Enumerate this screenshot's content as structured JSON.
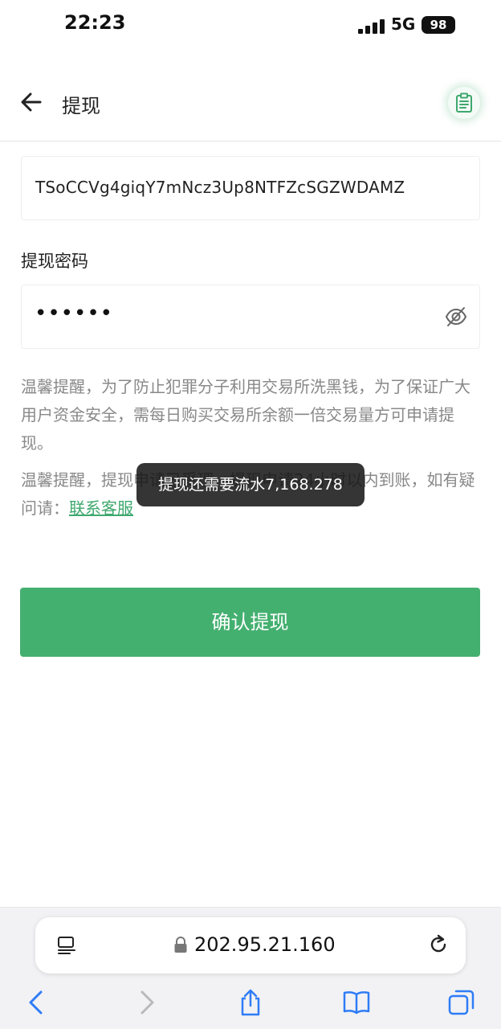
{
  "status_bar": {
    "time": "22:23",
    "network": "5G",
    "battery": "98"
  },
  "header": {
    "title": "提现"
  },
  "form": {
    "address_value": "TSoCCVg4giqY7mNcz3Up8NTFZcSGZWDAMZ",
    "password_label": "提现密码",
    "password_value": "••••••"
  },
  "notices": {
    "reminder1": "温馨提醒，为了防止犯罪分子利用交易所洗黑钱，为了保证广大用户资金安全，需每日购买交易所余额一倍交易量方可申请提现。",
    "reminder2_prefix": "温馨提醒，提现申请已受理，提现申请24小时以内到账，如有疑问请：",
    "customer_service_link": "联系客服"
  },
  "toast": {
    "message": "提现还需要流水7,168.278"
  },
  "actions": {
    "confirm_label": "确认提现"
  },
  "browser": {
    "url": "202.95.21.160"
  },
  "colors": {
    "accent_green": "#44b070",
    "link_green": "#3ea86e",
    "toast_bg": "#141414"
  }
}
